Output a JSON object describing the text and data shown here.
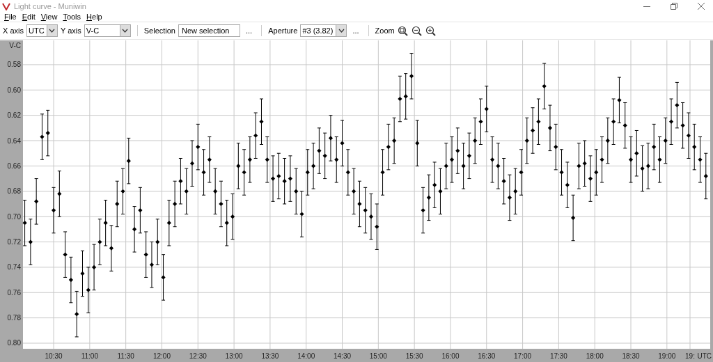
{
  "window": {
    "title": "Light curve - Muniwin"
  },
  "menu": [
    {
      "label": "File"
    },
    {
      "label": "Edit"
    },
    {
      "label": "View"
    },
    {
      "label": "Tools"
    },
    {
      "label": "Help"
    }
  ],
  "toolbar": {
    "x_axis": {
      "label": "X axis",
      "value": "UTC"
    },
    "y_axis": {
      "label": "Y axis",
      "value": "V-C"
    },
    "selection": {
      "label": "Selection",
      "value": "New selection",
      "more": "..."
    },
    "aperture": {
      "label": "Aperture",
      "value": "#3 (3.82)",
      "more": "..."
    },
    "zoom": {
      "label": "Zoom"
    }
  },
  "chart_data": {
    "type": "scatter",
    "grid": true,
    "xlabel": "UTC",
    "ylabel": "V-C",
    "xlim": [
      10.075,
      19.6
    ],
    "ylim": [
      0.8044,
      0.5608
    ],
    "xticks": [
      {
        "value": 10.5,
        "label": "10:30"
      },
      {
        "value": 11,
        "label": "11:00"
      },
      {
        "value": 11.5,
        "label": "11:30"
      },
      {
        "value": 12,
        "label": "12:00"
      },
      {
        "value": 12.5,
        "label": "12:30"
      },
      {
        "value": 13,
        "label": "13:00"
      },
      {
        "value": 13.5,
        "label": "13:30"
      },
      {
        "value": 14,
        "label": "14:00"
      },
      {
        "value": 14.5,
        "label": "14:30"
      },
      {
        "value": 15,
        "label": "15:00"
      },
      {
        "value": 15.5,
        "label": "15:30"
      },
      {
        "value": 16,
        "label": "16:00"
      },
      {
        "value": 16.5,
        "label": "16:30"
      },
      {
        "value": 17,
        "label": "17:00"
      },
      {
        "value": 17.5,
        "label": "17:30"
      },
      {
        "value": 18,
        "label": "18:00"
      },
      {
        "value": 18.5,
        "label": "18:30"
      },
      {
        "value": 19,
        "label": "19:00"
      },
      {
        "value": 19.32,
        "label": "19:"
      }
    ],
    "yticks": [
      {
        "value": 0.58,
        "label": "0.58"
      },
      {
        "value": 0.6,
        "label": "0.60"
      },
      {
        "value": 0.62,
        "label": "0.62"
      },
      {
        "value": 0.64,
        "label": "0.64"
      },
      {
        "value": 0.66,
        "label": "0.66"
      },
      {
        "value": 0.68,
        "label": "0.68"
      },
      {
        "value": 0.7,
        "label": "0.70"
      },
      {
        "value": 0.72,
        "label": "0.72"
      },
      {
        "value": 0.74,
        "label": "0.74"
      },
      {
        "value": 0.76,
        "label": "0.76"
      },
      {
        "value": 0.78,
        "label": "0.78"
      },
      {
        "value": 0.8,
        "label": "0.80"
      }
    ],
    "x": [
      10.1,
      10.18,
      10.26,
      10.34,
      10.42,
      10.5,
      10.58,
      10.66,
      10.74,
      10.82,
      10.9,
      10.98,
      11.06,
      11.14,
      11.22,
      11.3,
      11.38,
      11.46,
      11.54,
      11.62,
      11.7,
      11.78,
      11.86,
      11.94,
      12.02,
      12.1,
      12.18,
      12.26,
      12.34,
      12.42,
      12.5,
      12.58,
      12.66,
      12.74,
      12.82,
      12.9,
      12.98,
      13.06,
      13.14,
      13.22,
      13.3,
      13.38,
      13.46,
      13.54,
      13.62,
      13.7,
      13.78,
      13.86,
      13.94,
      14.02,
      14.1,
      14.18,
      14.26,
      14.34,
      14.42,
      14.5,
      14.58,
      14.66,
      14.74,
      14.82,
      14.9,
      14.98,
      15.06,
      15.14,
      15.22,
      15.3,
      15.38,
      15.46,
      15.54,
      15.62,
      15.7,
      15.78,
      15.86,
      15.94,
      16.02,
      16.1,
      16.18,
      16.26,
      16.34,
      16.42,
      16.5,
      16.58,
      16.66,
      16.74,
      16.82,
      16.9,
      16.98,
      17.06,
      17.14,
      17.22,
      17.3,
      17.38,
      17.46,
      17.54,
      17.62,
      17.7,
      17.78,
      17.86,
      17.94,
      18.02,
      18.1,
      18.18,
      18.26,
      18.34,
      18.42,
      18.5,
      18.58,
      18.66,
      18.74,
      18.82,
      18.9,
      18.98,
      19.06,
      19.14,
      19.22,
      19.3,
      19.38,
      19.46,
      19.54
    ],
    "series": [
      {
        "color": "#000000",
        "errors": [
          0.018,
          0.018,
          0.018,
          0.018,
          0.018,
          0.018,
          0.018,
          0.018,
          0.018,
          0.018,
          0.018,
          0.018,
          0.018,
          0.018,
          0.018,
          0.018,
          0.018,
          0.018,
          0.018,
          0.018,
          0.018,
          0.018,
          0.018,
          0.018,
          0.018,
          0.018,
          0.018,
          0.018,
          0.018,
          0.018,
          0.018,
          0.018,
          0.018,
          0.018,
          0.018,
          0.018,
          0.018,
          0.018,
          0.018,
          0.018,
          0.018,
          0.018,
          0.018,
          0.018,
          0.018,
          0.018,
          0.018,
          0.018,
          0.018,
          0.018,
          0.018,
          0.018,
          0.018,
          0.018,
          0.018,
          0.018,
          0.018,
          0.018,
          0.018,
          0.018,
          0.018,
          0.018,
          0.018,
          0.018,
          0.018,
          0.018,
          0.018,
          0.018,
          0.018,
          0.018,
          0.018,
          0.018,
          0.018,
          0.018,
          0.018,
          0.018,
          0.018,
          0.018,
          0.018,
          0.018,
          0.018,
          0.018,
          0.018,
          0.018,
          0.018,
          0.018,
          0.018,
          0.018,
          0.018,
          0.018,
          0.018,
          0.018,
          0.018,
          0.018,
          0.018,
          0.018,
          0.018,
          0.018,
          0.018,
          0.018,
          0.018,
          0.018,
          0.018,
          0.018,
          0.018,
          0.018,
          0.018,
          0.018,
          0.018,
          0.018,
          0.018,
          0.018,
          0.018,
          0.018,
          0.018,
          0.018,
          0.018,
          0.018,
          0.018
        ],
        "values": [
          0.705,
          0.72,
          0.688,
          0.637,
          0.634,
          0.695,
          0.682,
          0.73,
          0.75,
          0.777,
          0.745,
          0.758,
          0.74,
          0.72,
          0.705,
          0.725,
          0.69,
          0.68,
          0.656,
          0.71,
          0.695,
          0.73,
          0.738,
          0.72,
          0.748,
          0.705,
          0.69,
          0.672,
          0.68,
          0.658,
          0.645,
          0.665,
          0.655,
          0.68,
          0.69,
          0.705,
          0.7,
          0.66,
          0.665,
          0.655,
          0.636,
          0.625,
          0.655,
          0.67,
          0.668,
          0.672,
          0.67,
          0.68,
          0.698,
          0.665,
          0.66,
          0.648,
          0.652,
          0.638,
          0.655,
          0.642,
          0.665,
          0.68,
          0.69,
          0.695,
          0.7,
          0.708,
          0.665,
          0.645,
          0.64,
          0.607,
          0.605,
          0.589,
          0.642,
          0.695,
          0.685,
          0.675,
          0.68,
          0.66,
          0.655,
          0.648,
          0.66,
          0.652,
          0.64,
          0.625,
          0.615,
          0.655,
          0.66,
          0.672,
          0.685,
          0.68,
          0.665,
          0.64,
          0.632,
          0.625,
          0.597,
          0.63,
          0.645,
          0.665,
          0.675,
          0.701,
          0.66,
          0.658,
          0.67,
          0.665,
          0.655,
          0.64,
          0.625,
          0.608,
          0.628,
          0.655,
          0.65,
          0.662,
          0.66,
          0.645,
          0.655,
          0.64,
          0.625,
          0.612,
          0.628,
          0.636,
          0.645,
          0.655,
          0.668
        ]
      }
    ]
  }
}
